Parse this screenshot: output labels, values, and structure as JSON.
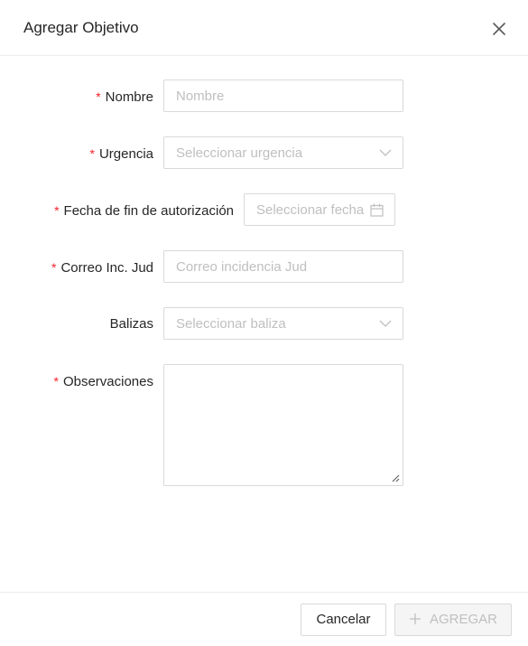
{
  "dialog": {
    "title": "Agregar Objetivo",
    "close_icon": "close-icon"
  },
  "form": {
    "required_mark": "*",
    "nombre": {
      "label": "Nombre",
      "placeholder": "Nombre",
      "required": true
    },
    "urgencia": {
      "label": "Urgencia",
      "placeholder": "Seleccionar urgencia",
      "required": true,
      "icon": "chevron-down-icon"
    },
    "fecha": {
      "label": "Fecha de fin de autorización",
      "placeholder": "Seleccionar fecha",
      "required": true,
      "icon": "calendar-icon"
    },
    "correo": {
      "label": "Correo Inc. Jud",
      "placeholder": "Correo incidencia Jud",
      "required": true
    },
    "balizas": {
      "label": "Balizas",
      "placeholder": "Seleccionar baliza",
      "required": false,
      "icon": "chevron-down-icon"
    },
    "observaciones": {
      "label": "Observaciones",
      "required": true,
      "value": ""
    }
  },
  "footer": {
    "cancel_label": "Cancelar",
    "add_label": "AGREGAR",
    "add_icon": "plus-icon",
    "add_disabled": true
  },
  "colors": {
    "required": "#f5222d",
    "border": "#d9d9d9",
    "placeholder": "#bfbfbf",
    "disabled_bg": "#f5f5f5"
  }
}
